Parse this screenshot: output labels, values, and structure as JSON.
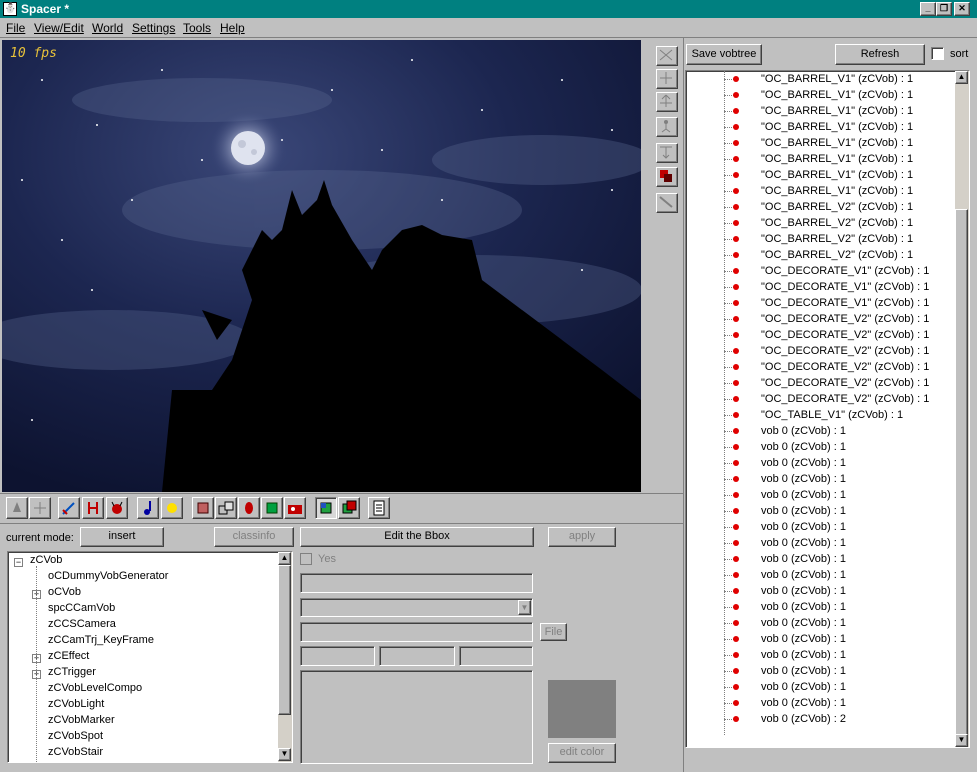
{
  "window": {
    "title": "Spacer *"
  },
  "menu": [
    "File",
    "View/Edit",
    "World",
    "Settings",
    "Tools",
    "Help"
  ],
  "viewport": {
    "fps": "10 fps"
  },
  "mode_panel": {
    "current_mode_label": "current mode:",
    "mode_button": "insert",
    "classinfo_button": "classinfo",
    "bbox_button": "Edit the Bbox",
    "apply_button": "apply",
    "yes_checkbox": "Yes",
    "file_button": "File",
    "edit_color_button": "edit color"
  },
  "class_tree": [
    {
      "label": "zCVob",
      "level": 0,
      "expander": "-"
    },
    {
      "label": "oCDummyVobGenerator",
      "level": 1,
      "expander": ""
    },
    {
      "label": "oCVob",
      "level": 1,
      "expander": "+"
    },
    {
      "label": "spcCCamVob",
      "level": 1,
      "expander": ""
    },
    {
      "label": "zCCSCamera",
      "level": 1,
      "expander": ""
    },
    {
      "label": "zCCamTrj_KeyFrame",
      "level": 1,
      "expander": ""
    },
    {
      "label": "zCEffect",
      "level": 1,
      "expander": "+"
    },
    {
      "label": "zCTrigger",
      "level": 1,
      "expander": "+"
    },
    {
      "label": "zCVobLevelCompo",
      "level": 1,
      "expander": ""
    },
    {
      "label": "zCVobLight",
      "level": 1,
      "expander": ""
    },
    {
      "label": "zCVobMarker",
      "level": 1,
      "expander": ""
    },
    {
      "label": "zCVobSpot",
      "level": 1,
      "expander": ""
    },
    {
      "label": "zCVobStair",
      "level": 1,
      "expander": ""
    }
  ],
  "vobtree_panel": {
    "save_button": "Save vobtree",
    "refresh_button": "Refresh",
    "sort_label": "sort",
    "items": [
      "\"OC_BARREL_V1\" (zCVob) : 1",
      "\"OC_BARREL_V1\" (zCVob) : 1",
      "\"OC_BARREL_V1\" (zCVob) : 1",
      "\"OC_BARREL_V1\" (zCVob) : 1",
      "\"OC_BARREL_V1\" (zCVob) : 1",
      "\"OC_BARREL_V1\" (zCVob) : 1",
      "\"OC_BARREL_V1\" (zCVob) : 1",
      "\"OC_BARREL_V1\" (zCVob) : 1",
      "\"OC_BARREL_V2\" (zCVob) : 1",
      "\"OC_BARREL_V2\" (zCVob) : 1",
      "\"OC_BARREL_V2\" (zCVob) : 1",
      "\"OC_BARREL_V2\" (zCVob) : 1",
      "\"OC_DECORATE_V1\" (zCVob) : 1",
      "\"OC_DECORATE_V1\" (zCVob) : 1",
      "\"OC_DECORATE_V1\" (zCVob) : 1",
      "\"OC_DECORATE_V2\" (zCVob) : 1",
      "\"OC_DECORATE_V2\" (zCVob) : 1",
      "\"OC_DECORATE_V2\" (zCVob) : 1",
      "\"OC_DECORATE_V2\" (zCVob) : 1",
      "\"OC_DECORATE_V2\" (zCVob) : 1",
      "\"OC_DECORATE_V2\" (zCVob) : 1",
      "\"OC_TABLE_V1\" (zCVob) : 1",
      "vob 0 (zCVob) : 1",
      "vob 0 (zCVob) : 1",
      "vob 0 (zCVob) : 1",
      "vob 0 (zCVob) : 1",
      "vob 0 (zCVob) : 1",
      "vob 0 (zCVob) : 1",
      "vob 0 (zCVob) : 1",
      "vob 0 (zCVob) : 1",
      "vob 0 (zCVob) : 1",
      "vob 0 (zCVob) : 1",
      "vob 0 (zCVob) : 1",
      "vob 0 (zCVob) : 1",
      "vob 0 (zCVob) : 1",
      "vob 0 (zCVob) : 1",
      "vob 0 (zCVob) : 1",
      "vob 0 (zCVob) : 1",
      "vob 0 (zCVob) : 1",
      "vob 0 (zCVob) : 1",
      "vob 0 (zCVob) : 2"
    ]
  },
  "colors": {
    "titlebar": "#008080",
    "window": "#c0c0c0",
    "vob_dot": "#e00000",
    "sky": "#1a2346",
    "fps_text": "#e8c23a"
  }
}
